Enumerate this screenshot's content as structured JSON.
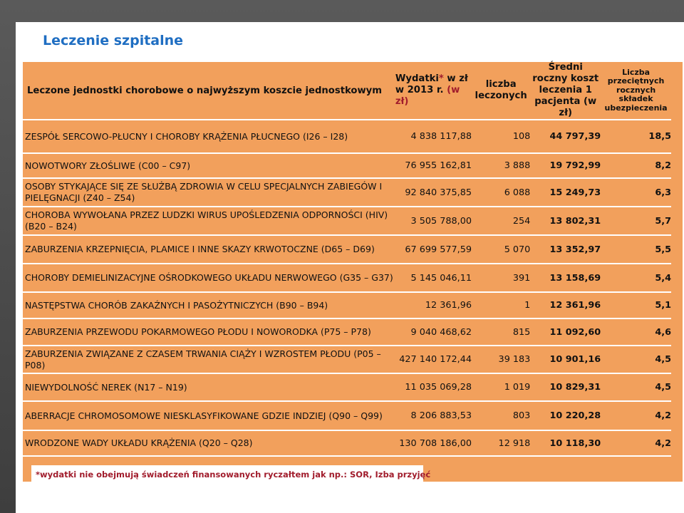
{
  "title": "Leczenie szpitalne",
  "table": {
    "header": {
      "col0": "Leczone jednostki chorobowe o najwyższym koszcie jednostkowym",
      "col1": "Wydatki* w zł w 2013 r. (w zł)",
      "col2": "liczba leczonych",
      "col3": "Średni roczny koszt leczenia 1 pacjenta (w zł)",
      "col4": "Liczba przeciętnych rocznych składek ubezpieczenia"
    },
    "rows": [
      {
        "name": "ZESPÓŁ SERCOWO-PŁUCNY I CHOROBY KRĄŻENIA PŁUCNEGO (I26 – I28)",
        "expenses": "4 838 117,88",
        "treated": "108",
        "avg_cost": "44 797,39",
        "contributions": "18,5"
      },
      {
        "name": "NOWOTWORY ZŁOŚLIWE (C00 – C97)",
        "expenses": "76 955 162,81",
        "treated": "3 888",
        "avg_cost": "19 792,99",
        "contributions": "8,2"
      },
      {
        "name": "OSOBY STYKAJĄCE SIĘ ZE SŁUŻBĄ ZDROWIA W CELU SPECJALNYCH ZABIEGÓW I PIELĘGNACJI (Z40 – Z54)",
        "expenses": "92 840 375,85",
        "treated": "6 088",
        "avg_cost": "15 249,73",
        "contributions": "6,3"
      },
      {
        "name": "CHOROBA WYWOŁANA PRZEZ LUDZKI WIRUS UPOŚLEDZENIA ODPORNOŚCI (HIV) (B20 – B24)",
        "expenses": "3 505 788,00",
        "treated": "254",
        "avg_cost": "13 802,31",
        "contributions": "5,7"
      },
      {
        "name": "ZABURZENIA KRZEPNIĘCIA, PLAMICE I INNE SKAZY KRWOTOCZNE (D65 – D69)",
        "expenses": "67 699 577,59",
        "treated": "5 070",
        "avg_cost": "13 352,97",
        "contributions": "5,5"
      },
      {
        "name": "CHOROBY DEMIELINIZACYJNE OŚRODKOWEGO UKŁADU NERWOWEGO (G35 – G37)",
        "expenses": "5 145 046,11",
        "treated": "391",
        "avg_cost": "13 158,69",
        "contributions": "5,4"
      },
      {
        "name": "NASTĘPSTWA CHORÓB ZAKAŹNYCH I PASOŻYTNICZYCH (B90 – B94)",
        "expenses": "12 361,96",
        "treated": "1",
        "avg_cost": "12 361,96",
        "contributions": "5,1"
      },
      {
        "name": "ZABURZENIA PRZEWODU POKARMOWEGO PŁODU I NOWORODKA (P75 – P78)",
        "expenses": "9 040 468,62",
        "treated": "815",
        "avg_cost": "11 092,60",
        "contributions": "4,6"
      },
      {
        "name": "ZABURZENIA ZWIĄZANE Z CZASEM TRWANIA CIĄŻY I WZROSTEM PŁODU (P05 – P08)",
        "expenses": "427 140 172,44",
        "treated": "39 183",
        "avg_cost": "10 901,16",
        "contributions": "4,5"
      },
      {
        "name": "NIEWYDOLNOŚĆ NEREK (N17 – N19)",
        "expenses": "11 035 069,28",
        "treated": "1 019",
        "avg_cost": "10 829,31",
        "contributions": "4,5"
      },
      {
        "name": "ABERRACJE CHROMOSOMOWE NIESKLASYFIKOWANE GDZIE INDZIEJ (Q90 – Q99)",
        "expenses": "8 206 883,53",
        "treated": "803",
        "avg_cost": "10 220,28",
        "contributions": "4,2"
      },
      {
        "name": "WRODZONE WADY UKŁADU KRĄŻENIA (Q20 – Q28)",
        "expenses": "130 708 186,00",
        "treated": "12 918",
        "avg_cost": "10 118,30",
        "contributions": "4,2"
      }
    ]
  },
  "footnote": "*wydatki nie obejmują świadczeń finansowanych ryczałtem jak np.: SOR, Izba przyjęć",
  "colors": {
    "title": "#1f6ec2",
    "table_bg": "#f2a05c",
    "header_accent": "#a11c2c",
    "footnote": "#a11c2c",
    "background": "#4a4a4a"
  }
}
